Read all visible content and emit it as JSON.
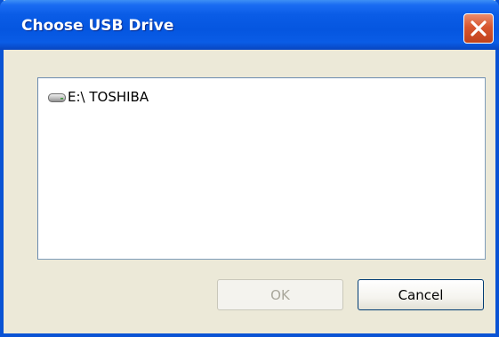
{
  "window": {
    "title": "Choose USB Drive"
  },
  "drives": [
    {
      "label": "E:\\ TOSHIBA",
      "icon": "usb-drive-icon"
    }
  ],
  "buttons": {
    "ok_label": "OK",
    "ok_enabled": false,
    "cancel_label": "Cancel"
  },
  "colors": {
    "titlebar": "#0556e0",
    "close_button": "#d8562f",
    "dialog_background": "#ece9d8"
  }
}
